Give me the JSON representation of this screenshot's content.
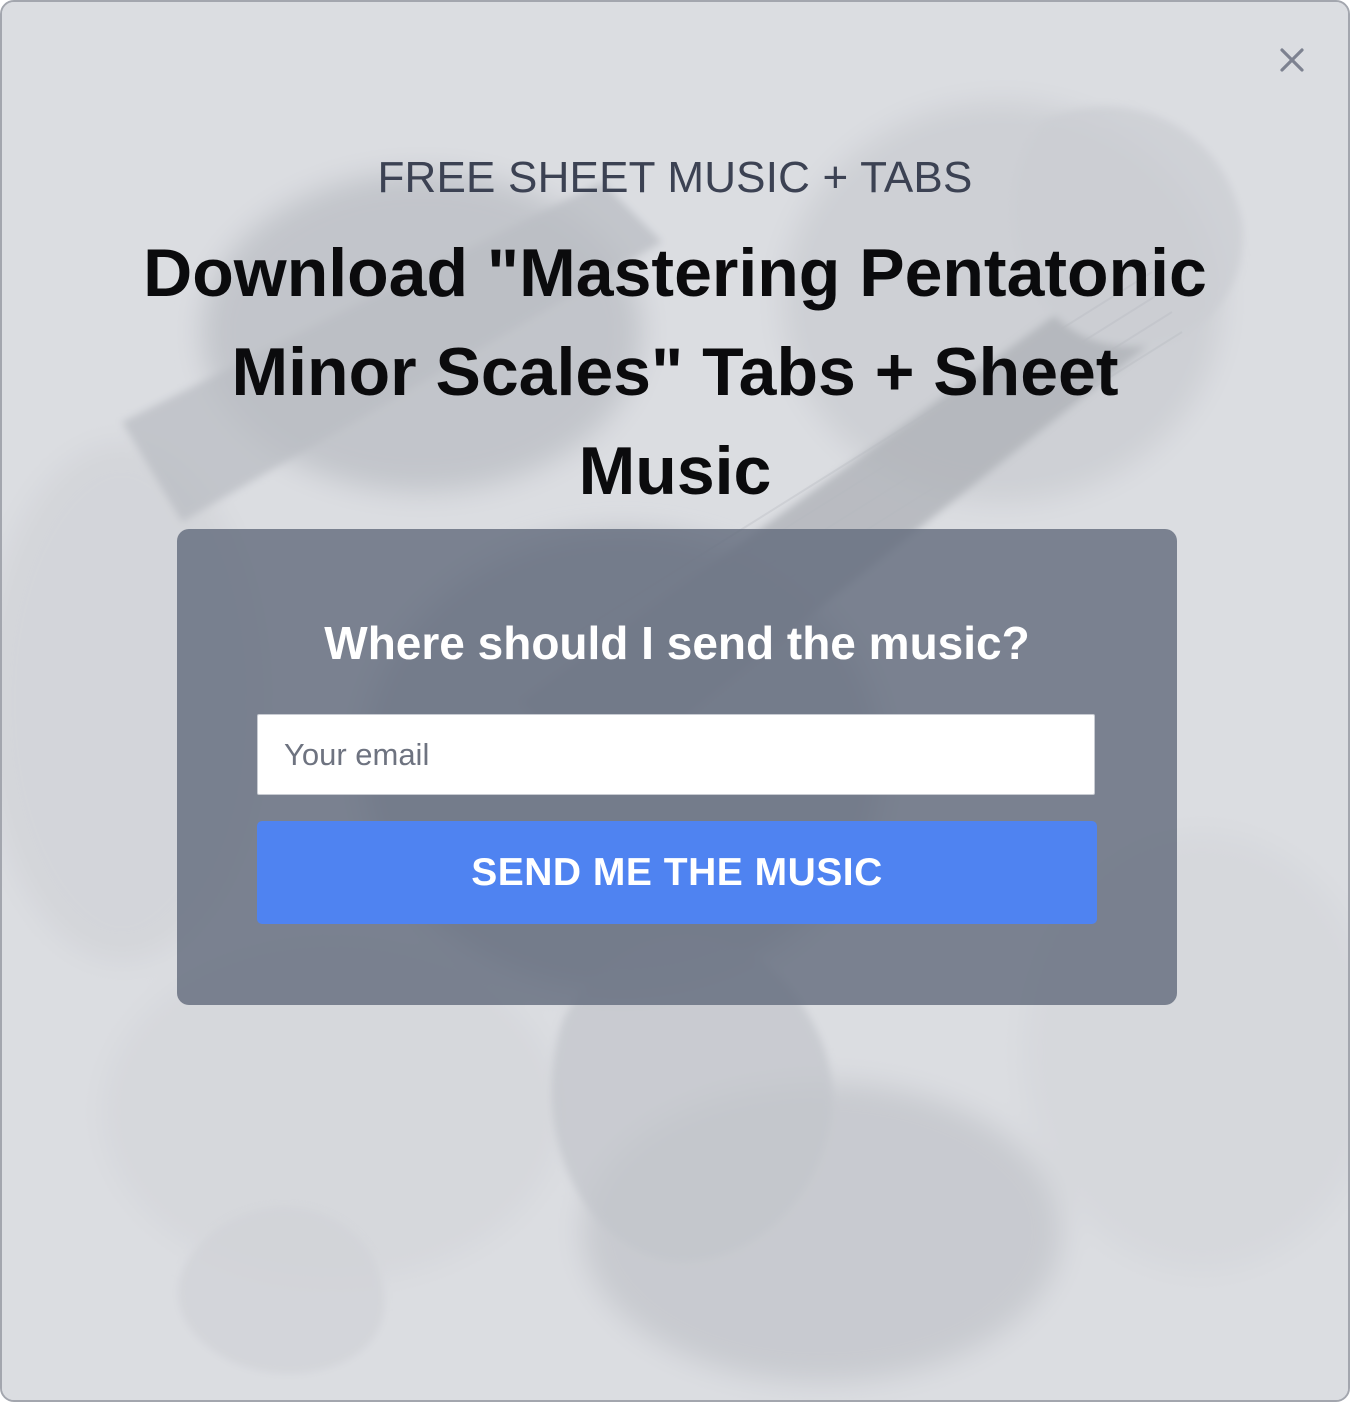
{
  "modal": {
    "close_icon": "close-icon",
    "background_image": "guitar-player-photo",
    "eyebrow": "FREE SHEET MUSIC + TABS",
    "headline": "Download \"Mastering Pentatonic Minor Scales\" Tabs + Sheet Music"
  },
  "form": {
    "question": "Where should I send the music?",
    "email_placeholder": "Your email",
    "email_value": "",
    "submit_label": "SEND ME THE MUSIC"
  },
  "colors": {
    "accent_button": "#4f83f1",
    "form_panel": "#6f7789",
    "headline_text": "#0b0b0d",
    "eyebrow_text": "#3c4253"
  }
}
